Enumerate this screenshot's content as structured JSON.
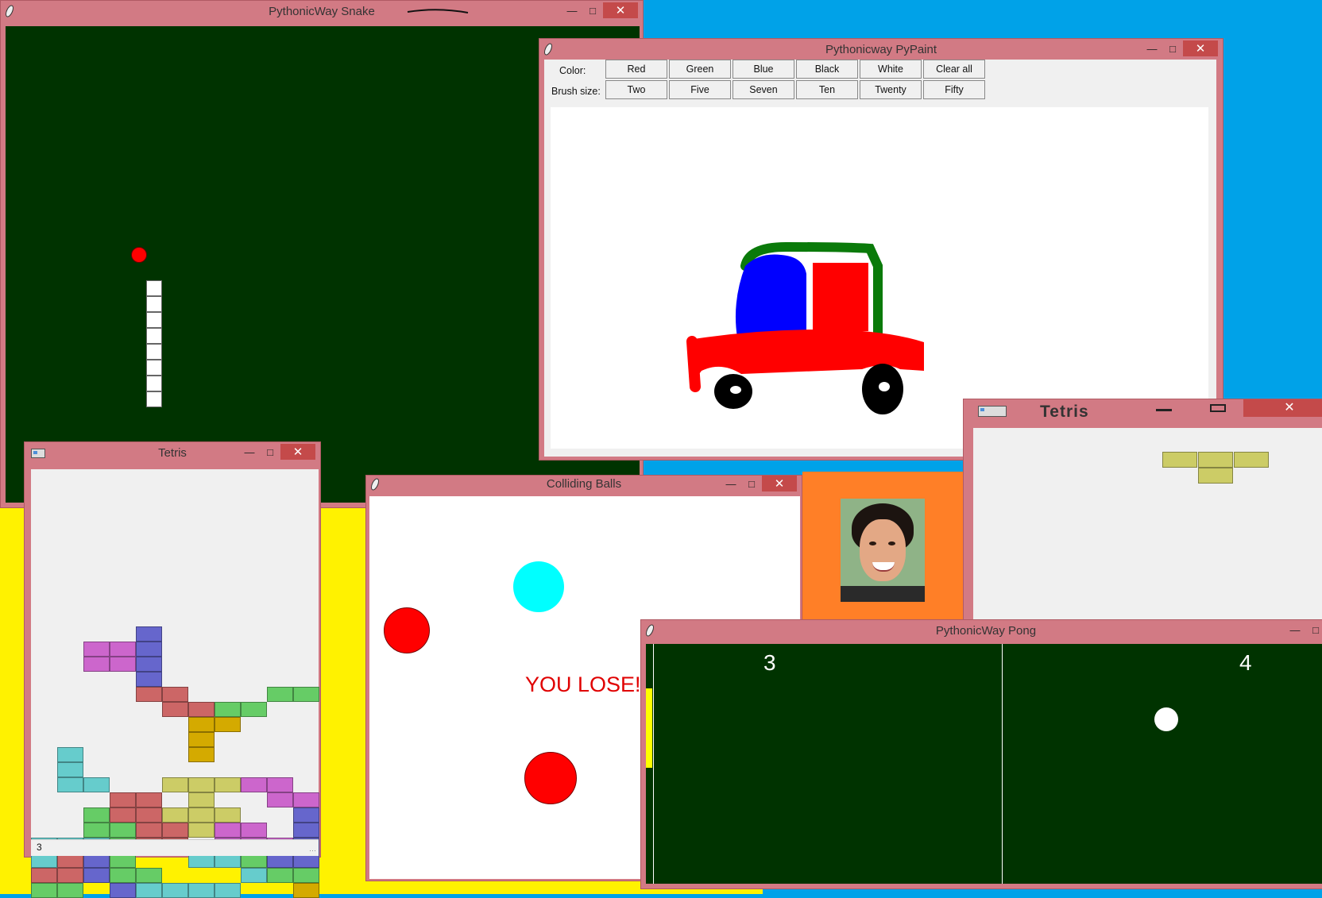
{
  "desktop": {
    "bg_blue": "#00a2e8",
    "bg_yellow": "#fff200"
  },
  "snake": {
    "title": "PythonicWay Snake",
    "board_color": "#003300",
    "food_color": "#ff0000",
    "snake_color": "#ffffff",
    "segments": 8
  },
  "paint": {
    "title": "Pythonicway PyPaint",
    "color_label": "Color:",
    "brush_label": "Brush size:",
    "colors": [
      "Red",
      "Green",
      "Blue",
      "Black",
      "White",
      "Clear all"
    ],
    "sizes": [
      "Two",
      "Five",
      "Seven",
      "Ten",
      "Twenty",
      "Fifty"
    ]
  },
  "tetris_small": {
    "title": "Tetris",
    "status": "3"
  },
  "tetris_big": {
    "title": "Tetris"
  },
  "balls": {
    "title": "Colliding Balls",
    "message": "YOU LOSE!"
  },
  "pong": {
    "title": "PythonicWay Pong",
    "score_left": "3",
    "score_right": "4",
    "board_color": "#003300",
    "paddle_color": "#ffff00"
  },
  "icons": {
    "window": "feather-icon",
    "tetris": "window-app-icon"
  }
}
